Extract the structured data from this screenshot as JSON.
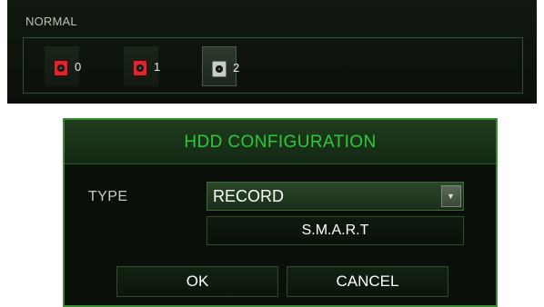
{
  "disk_panel": {
    "title": "NORMAL",
    "disks": [
      {
        "label": "0",
        "status": "red"
      },
      {
        "label": "1",
        "status": "red"
      },
      {
        "label": "2",
        "status": "gray"
      }
    ]
  },
  "dialog": {
    "title": "HDD CONFIGURATION",
    "type_label": "TYPE",
    "type_value": "RECORD",
    "smart_label": "S.M.A.R.T",
    "ok_label": "OK",
    "cancel_label": "CANCEL"
  },
  "colors": {
    "accent_green": "#2fc93a",
    "disk_red": "#e0232c",
    "disk_gray": "#c9cdc6",
    "cursor_blue": "#1f7ff0"
  },
  "icons": {
    "disk": "hdd-icon",
    "dropdown": "chevron-down-icon",
    "cursor": "mouse-cursor-icon"
  }
}
